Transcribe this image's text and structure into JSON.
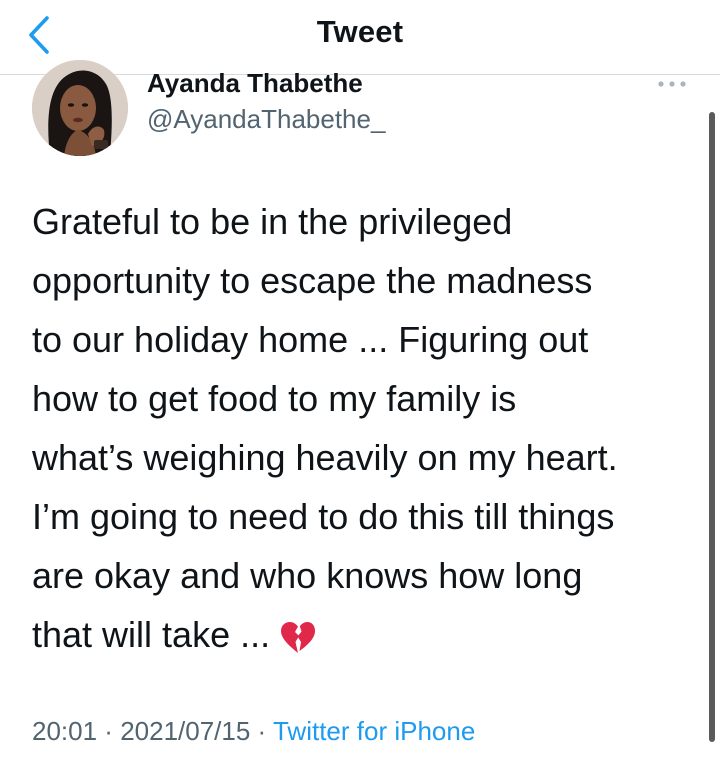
{
  "header": {
    "title": "Tweet"
  },
  "author": {
    "name": "Ayanda Thabethe",
    "handle": "@AyandaThabethe_"
  },
  "tweet": {
    "text": "Grateful to be in the privileged\nopportunity to escape the madness\nto our holiday home  ... Figuring out\nhow to get food to my family is\nwhat’s weighing heavily on my heart.\nI’m going to need to do this till things\nare okay and who knows how long\nthat will take ...",
    "emoji": "broken-heart-emoji"
  },
  "meta": {
    "time": "20:01",
    "separator1": " · ",
    "date": "2021/07/15",
    "separator2": " · ",
    "source": "Twitter for iPhone"
  },
  "icons": {
    "back": "chevron-left-icon",
    "more": "more-horizontal-icon"
  },
  "colors": {
    "accent": "#1d9bf0",
    "secondary_text": "#536471",
    "emoji_red": "#e0284a"
  }
}
